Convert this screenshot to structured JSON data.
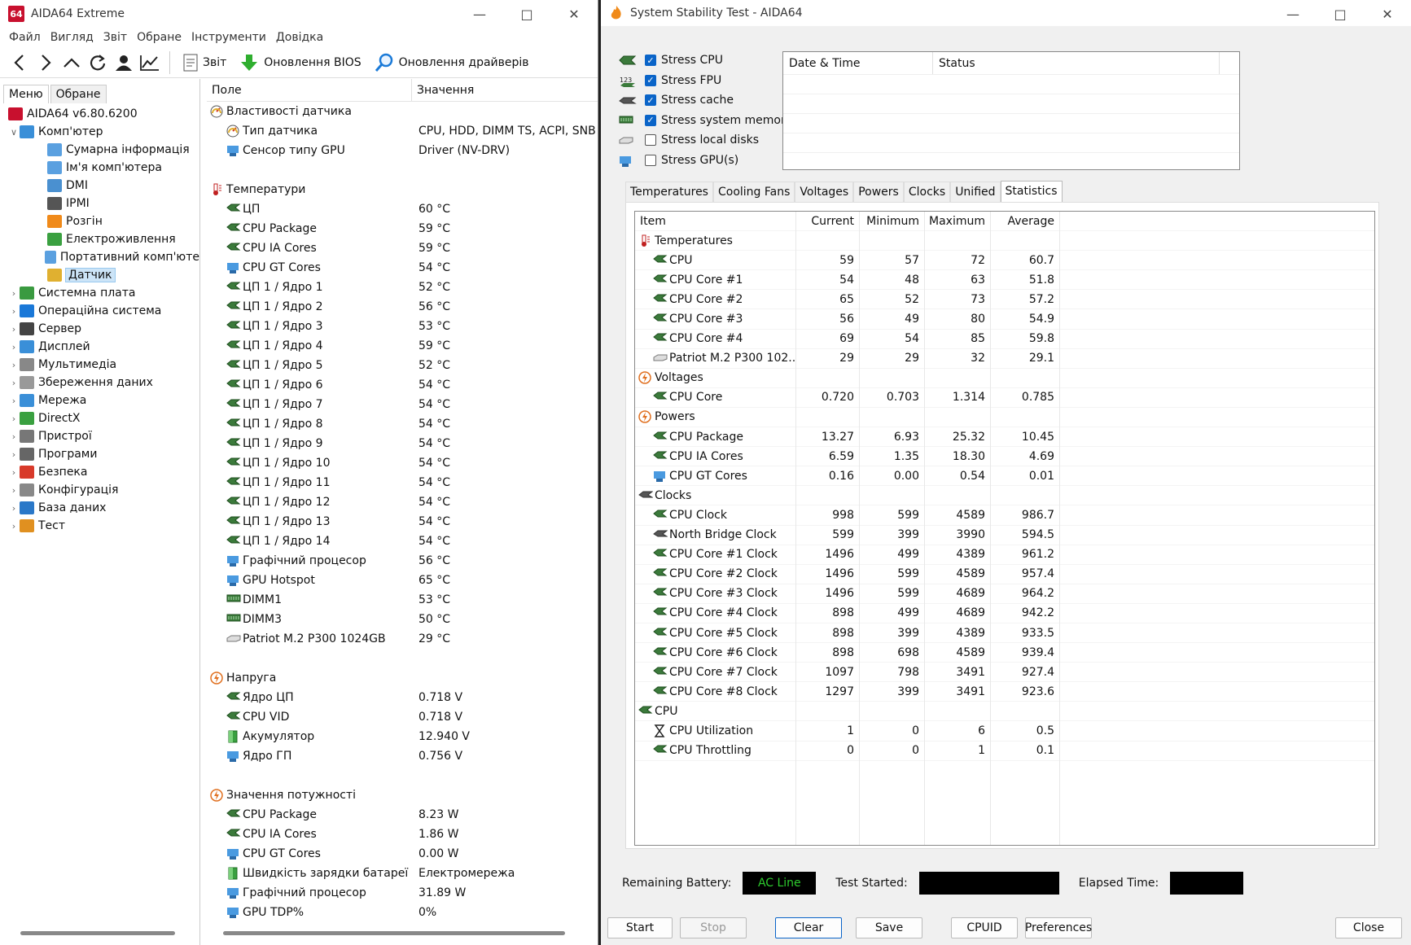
{
  "aida": {
    "title": "AIDA64 Extreme",
    "icon_text": "64",
    "menu": [
      "Файл",
      "Вигляд",
      "Звіт",
      "Обране",
      "Інструменти",
      "Довідка"
    ],
    "toolbar": {
      "report": "Звіт",
      "bios_update": "Оновлення BIOS",
      "driver_update": "Оновлення драйверів"
    },
    "pane_tabs": [
      "Меню",
      "Обране"
    ],
    "tree": [
      {
        "label": "AIDA64 v6.80.6200",
        "level": 0,
        "exp": "",
        "icon": "aida-icon",
        "color": "#c8102e"
      },
      {
        "label": "Комп'ютер",
        "level": 0,
        "exp": "v",
        "icon": "computer-icon",
        "color": "#3a8fd8"
      },
      {
        "label": "Сумарна інформація",
        "level": 1,
        "exp": "",
        "icon": "summary-icon",
        "color": "#5aa0e0"
      },
      {
        "label": "Ім'я комп'ютера",
        "level": 1,
        "exp": "",
        "icon": "computer-name-icon",
        "color": "#5aa0e0"
      },
      {
        "label": "DMI",
        "level": 1,
        "exp": "",
        "icon": "dmi-icon",
        "color": "#4a90d0"
      },
      {
        "label": "IPMI",
        "level": 1,
        "exp": "",
        "icon": "ipmi-icon",
        "color": "#555555"
      },
      {
        "label": "Розгін",
        "level": 1,
        "exp": "",
        "icon": "overclock-icon",
        "color": "#f08a1a"
      },
      {
        "label": "Електроживлення",
        "level": 1,
        "exp": "",
        "icon": "power-icon",
        "color": "#3aa040"
      },
      {
        "label": "Портативний комп'юте",
        "level": 1,
        "exp": "",
        "icon": "laptop-icon",
        "color": "#5aa0e0"
      },
      {
        "label": "Датчик",
        "level": 1,
        "exp": "",
        "icon": "sensor-icon",
        "color": "#e0b030",
        "selected": true
      },
      {
        "label": "Системна плата",
        "level": 0,
        "exp": ">",
        "icon": "motherboard-icon",
        "color": "#3a9a40"
      },
      {
        "label": "Операційна система",
        "level": 0,
        "exp": ">",
        "icon": "windows-icon",
        "color": "#1a78d8"
      },
      {
        "label": "Сервер",
        "level": 0,
        "exp": ">",
        "icon": "server-icon",
        "color": "#444444"
      },
      {
        "label": "Дисплей",
        "level": 0,
        "exp": ">",
        "icon": "display-icon",
        "color": "#3a8fd8"
      },
      {
        "label": "Мультимедіа",
        "level": 0,
        "exp": ">",
        "icon": "multimedia-icon",
        "color": "#888888"
      },
      {
        "label": "Збереження даних",
        "level": 0,
        "exp": ">",
        "icon": "storage-icon",
        "color": "#999999"
      },
      {
        "label": "Мережа",
        "level": 0,
        "exp": ">",
        "icon": "network-icon",
        "color": "#3a8fd8"
      },
      {
        "label": "DirectX",
        "level": 0,
        "exp": ">",
        "icon": "directx-icon",
        "color": "#3aa040"
      },
      {
        "label": "Пристрої",
        "level": 0,
        "exp": ">",
        "icon": "devices-icon",
        "color": "#777777"
      },
      {
        "label": "Програми",
        "level": 0,
        "exp": ">",
        "icon": "programs-icon",
        "color": "#666666"
      },
      {
        "label": "Безпека",
        "level": 0,
        "exp": ">",
        "icon": "security-icon",
        "color": "#d83a2a"
      },
      {
        "label": "Конфігурація",
        "level": 0,
        "exp": ">",
        "icon": "config-icon",
        "color": "#888888"
      },
      {
        "label": "База даних",
        "level": 0,
        "exp": ">",
        "icon": "database-icon",
        "color": "#2a78c8"
      },
      {
        "label": "Тест",
        "level": 0,
        "exp": ">",
        "icon": "test-icon",
        "color": "#e09020"
      }
    ],
    "columns": [
      "Поле",
      "Значення"
    ],
    "rows": [
      {
        "type": "section",
        "name": "Властивості датчика",
        "value": "",
        "icon": "sensor-icon"
      },
      {
        "type": "item",
        "name": "Тип датчика",
        "value": "CPU, HDD, DIMM TS, ACPI, SNB",
        "icon": "sensor-icon"
      },
      {
        "type": "item",
        "name": "Сенсор типу GPU",
        "value": "Driver  (NV-DRV)",
        "icon": "gpu-icon"
      },
      {
        "type": "blank"
      },
      {
        "type": "section",
        "name": "Температури",
        "value": "",
        "icon": "thermometer-icon"
      },
      {
        "type": "item",
        "name": "ЦП",
        "value": "60 °C",
        "icon": "cpu-icon"
      },
      {
        "type": "item",
        "name": "CPU Package",
        "value": "59 °C",
        "icon": "cpu-icon"
      },
      {
        "type": "item",
        "name": "CPU IA Cores",
        "value": "59 °C",
        "icon": "cpu-icon"
      },
      {
        "type": "item",
        "name": "CPU GT Cores",
        "value": "54 °C",
        "icon": "gpu-icon"
      },
      {
        "type": "item",
        "name": "ЦП 1 / Ядро 1",
        "value": "52 °C",
        "icon": "cpu-icon"
      },
      {
        "type": "item",
        "name": "ЦП 1 / Ядро 2",
        "value": "56 °C",
        "icon": "cpu-icon"
      },
      {
        "type": "item",
        "name": "ЦП 1 / Ядро 3",
        "value": "53 °C",
        "icon": "cpu-icon"
      },
      {
        "type": "item",
        "name": "ЦП 1 / Ядро 4",
        "value": "59 °C",
        "icon": "cpu-icon"
      },
      {
        "type": "item",
        "name": "ЦП 1 / Ядро 5",
        "value": "52 °C",
        "icon": "cpu-icon"
      },
      {
        "type": "item",
        "name": "ЦП 1 / Ядро 6",
        "value": "54 °C",
        "icon": "cpu-icon"
      },
      {
        "type": "item",
        "name": "ЦП 1 / Ядро 7",
        "value": "54 °C",
        "icon": "cpu-icon"
      },
      {
        "type": "item",
        "name": "ЦП 1 / Ядро 8",
        "value": "54 °C",
        "icon": "cpu-icon"
      },
      {
        "type": "item",
        "name": "ЦП 1 / Ядро 9",
        "value": "54 °C",
        "icon": "cpu-icon"
      },
      {
        "type": "item",
        "name": "ЦП 1 / Ядро 10",
        "value": "54 °C",
        "icon": "cpu-icon"
      },
      {
        "type": "item",
        "name": "ЦП 1 / Ядро 11",
        "value": "54 °C",
        "icon": "cpu-icon"
      },
      {
        "type": "item",
        "name": "ЦП 1 / Ядро 12",
        "value": "54 °C",
        "icon": "cpu-icon"
      },
      {
        "type": "item",
        "name": "ЦП 1 / Ядро 13",
        "value": "54 °C",
        "icon": "cpu-icon"
      },
      {
        "type": "item",
        "name": "ЦП 1 / Ядро 14",
        "value": "54 °C",
        "icon": "cpu-icon"
      },
      {
        "type": "item",
        "name": "Графічний процесор",
        "value": "56 °C",
        "icon": "gpu-icon"
      },
      {
        "type": "item",
        "name": "GPU Hotspot",
        "value": "65 °C",
        "icon": "gpu-icon"
      },
      {
        "type": "item",
        "name": "DIMM1",
        "value": "53 °C",
        "icon": "memory-icon"
      },
      {
        "type": "item",
        "name": "DIMM3",
        "value": "50 °C",
        "icon": "memory-icon"
      },
      {
        "type": "item",
        "name": "Patriot M.2 P300 1024GB",
        "value": "29 °C",
        "icon": "disk-icon"
      },
      {
        "type": "blank"
      },
      {
        "type": "section",
        "name": "Напруга",
        "value": "",
        "icon": "voltage-icon"
      },
      {
        "type": "item",
        "name": "Ядро ЦП",
        "value": "0.718 V",
        "icon": "cpu-icon"
      },
      {
        "type": "item",
        "name": "CPU VID",
        "value": "0.718 V",
        "icon": "cpu-icon"
      },
      {
        "type": "item",
        "name": "Акумулятор",
        "value": "12.940 V",
        "icon": "battery-icon"
      },
      {
        "type": "item",
        "name": "Ядро ГП",
        "value": "0.756 V",
        "icon": "gpu-icon"
      },
      {
        "type": "blank"
      },
      {
        "type": "section",
        "name": "Значення потужності",
        "value": "",
        "icon": "voltage-icon"
      },
      {
        "type": "item",
        "name": "CPU Package",
        "value": "8.23 W",
        "icon": "cpu-icon"
      },
      {
        "type": "item",
        "name": "CPU IA Cores",
        "value": "1.86 W",
        "icon": "cpu-icon"
      },
      {
        "type": "item",
        "name": "CPU GT Cores",
        "value": "0.00 W",
        "icon": "gpu-icon"
      },
      {
        "type": "item",
        "name": "Швидкість зарядки батареї",
        "value": "Електромережа",
        "icon": "battery-icon"
      },
      {
        "type": "item",
        "name": "Графічний процесор",
        "value": "31.89 W",
        "icon": "gpu-icon"
      },
      {
        "type": "item",
        "name": "GPU TDP%",
        "value": "0%",
        "icon": "gpu-icon"
      }
    ]
  },
  "sst": {
    "title": "System Stability Test - AIDA64",
    "stress": [
      {
        "label": "Stress CPU",
        "checked": true,
        "icon": "cpu-chip-icon"
      },
      {
        "label": "Stress FPU",
        "checked": true,
        "icon": "fpu-icon"
      },
      {
        "label": "Stress cache",
        "checked": true,
        "icon": "cache-icon"
      },
      {
        "label": "Stress system memory",
        "checked": true,
        "icon": "memory-icon"
      },
      {
        "label": "Stress local disks",
        "checked": false,
        "icon": "disk-icon"
      },
      {
        "label": "Stress GPU(s)",
        "checked": false,
        "icon": "gpu-icon"
      }
    ],
    "log_columns": [
      "Date & Time",
      "Status"
    ],
    "tabs": [
      "Temperatures",
      "Cooling Fans",
      "Voltages",
      "Powers",
      "Clocks",
      "Unified",
      "Statistics"
    ],
    "active_tab": "Statistics",
    "stat_columns": [
      "Item",
      "Current",
      "Minimum",
      "Maximum",
      "Average"
    ],
    "stats": [
      {
        "type": "sec",
        "name": "Temperatures",
        "icon": "thermometer-icon"
      },
      {
        "type": "itm",
        "name": "CPU",
        "icon": "cpu-icon",
        "cur": "59",
        "min": "57",
        "max": "72",
        "avg": "60.7"
      },
      {
        "type": "itm",
        "name": "CPU Core #1",
        "icon": "cpu-icon",
        "cur": "54",
        "min": "48",
        "max": "63",
        "avg": "51.8"
      },
      {
        "type": "itm",
        "name": "CPU Core #2",
        "icon": "cpu-icon",
        "cur": "65",
        "min": "52",
        "max": "73",
        "avg": "57.2"
      },
      {
        "type": "itm",
        "name": "CPU Core #3",
        "icon": "cpu-icon",
        "cur": "56",
        "min": "49",
        "max": "80",
        "avg": "54.9"
      },
      {
        "type": "itm",
        "name": "CPU Core #4",
        "icon": "cpu-icon",
        "cur": "69",
        "min": "54",
        "max": "85",
        "avg": "59.8"
      },
      {
        "type": "itm",
        "name": "Patriot M.2 P300 102...",
        "icon": "disk-icon",
        "cur": "29",
        "min": "29",
        "max": "32",
        "avg": "29.1"
      },
      {
        "type": "sec",
        "name": "Voltages",
        "icon": "voltage-icon"
      },
      {
        "type": "itm",
        "name": "CPU Core",
        "icon": "cpu-icon",
        "cur": "0.720",
        "min": "0.703",
        "max": "1.314",
        "avg": "0.785"
      },
      {
        "type": "sec",
        "name": "Powers",
        "icon": "voltage-icon"
      },
      {
        "type": "itm",
        "name": "CPU Package",
        "icon": "cpu-icon",
        "cur": "13.27",
        "min": "6.93",
        "max": "25.32",
        "avg": "10.45"
      },
      {
        "type": "itm",
        "name": "CPU IA Cores",
        "icon": "cpu-icon",
        "cur": "6.59",
        "min": "1.35",
        "max": "18.30",
        "avg": "4.69"
      },
      {
        "type": "itm",
        "name": "CPU GT Cores",
        "icon": "gpu-icon",
        "cur": "0.16",
        "min": "0.00",
        "max": "0.54",
        "avg": "0.01"
      },
      {
        "type": "sec",
        "name": "Clocks",
        "icon": "clock-icon"
      },
      {
        "type": "itm",
        "name": "CPU Clock",
        "icon": "cpu-icon",
        "cur": "998",
        "min": "599",
        "max": "4589",
        "avg": "986.7"
      },
      {
        "type": "itm",
        "name": "North Bridge Clock",
        "icon": "chipset-icon",
        "cur": "599",
        "min": "399",
        "max": "3990",
        "avg": "594.5"
      },
      {
        "type": "itm",
        "name": "CPU Core #1 Clock",
        "icon": "cpu-icon",
        "cur": "1496",
        "min": "499",
        "max": "4389",
        "avg": "961.2"
      },
      {
        "type": "itm",
        "name": "CPU Core #2 Clock",
        "icon": "cpu-icon",
        "cur": "1496",
        "min": "599",
        "max": "4589",
        "avg": "957.4"
      },
      {
        "type": "itm",
        "name": "CPU Core #3 Clock",
        "icon": "cpu-icon",
        "cur": "1496",
        "min": "599",
        "max": "4689",
        "avg": "964.2"
      },
      {
        "type": "itm",
        "name": "CPU Core #4 Clock",
        "icon": "cpu-icon",
        "cur": "898",
        "min": "499",
        "max": "4689",
        "avg": "942.2"
      },
      {
        "type": "itm",
        "name": "CPU Core #5 Clock",
        "icon": "cpu-icon",
        "cur": "898",
        "min": "399",
        "max": "4389",
        "avg": "933.5"
      },
      {
        "type": "itm",
        "name": "CPU Core #6 Clock",
        "icon": "cpu-icon",
        "cur": "898",
        "min": "698",
        "max": "4589",
        "avg": "939.4"
      },
      {
        "type": "itm",
        "name": "CPU Core #7 Clock",
        "icon": "cpu-icon",
        "cur": "1097",
        "min": "798",
        "max": "3491",
        "avg": "927.4"
      },
      {
        "type": "itm",
        "name": "CPU Core #8 Clock",
        "icon": "cpu-icon",
        "cur": "1297",
        "min": "399",
        "max": "3491",
        "avg": "923.6"
      },
      {
        "type": "sec",
        "name": "CPU",
        "icon": "cpu-icon"
      },
      {
        "type": "itm",
        "name": "CPU Utilization",
        "icon": "hourglass-icon",
        "cur": "1",
        "min": "0",
        "max": "6",
        "avg": "0.5"
      },
      {
        "type": "itm",
        "name": "CPU Throttling",
        "icon": "cpu-icon",
        "cur": "0",
        "min": "0",
        "max": "1",
        "avg": "0.1"
      }
    ],
    "bottom": {
      "battery_label": "Remaining Battery:",
      "battery_value": "AC Line",
      "started_label": "Test Started:",
      "started_value": "",
      "elapsed_label": "Elapsed Time:",
      "elapsed_value": ""
    },
    "buttons": {
      "start": "Start",
      "stop": "Stop",
      "clear": "Clear",
      "save": "Save",
      "cpuid": "CPUID",
      "preferences": "Preferences",
      "close": "Close"
    },
    "colors": {
      "accent": "#0a64c8",
      "ac_line_text": "#2ecc2e",
      "brand_red": "#c8102e"
    }
  }
}
